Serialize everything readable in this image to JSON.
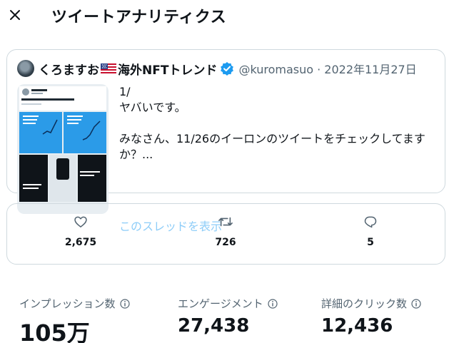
{
  "header": {
    "title": "ツイートアナリティクス"
  },
  "tweet": {
    "author_name": "くろますお",
    "author_suffix": "海外NFTトレンド",
    "handle_meta": "@kuromasuo · 2022年11月27日",
    "text_lines": [
      "1/",
      "ヤバいです。",
      "",
      "みなさん、11/26のイーロンのツイートをチェックしてます",
      "か？..."
    ],
    "show_thread_label": "このスレッドを表示"
  },
  "engagement": {
    "likes": "2,675",
    "retweets": "726",
    "replies": "5"
  },
  "metrics": [
    {
      "label": "インプレッション数",
      "value": "105万"
    },
    {
      "label": "エンゲージメント",
      "value": "27,438"
    },
    {
      "label": "詳細のクリック数",
      "value": "12,436"
    }
  ],
  "colors": {
    "text": "#0f1419",
    "muted": "#536471",
    "border": "#cfd9de",
    "verified": "#1d9bf0",
    "link_faded": "#8ecdf8"
  }
}
